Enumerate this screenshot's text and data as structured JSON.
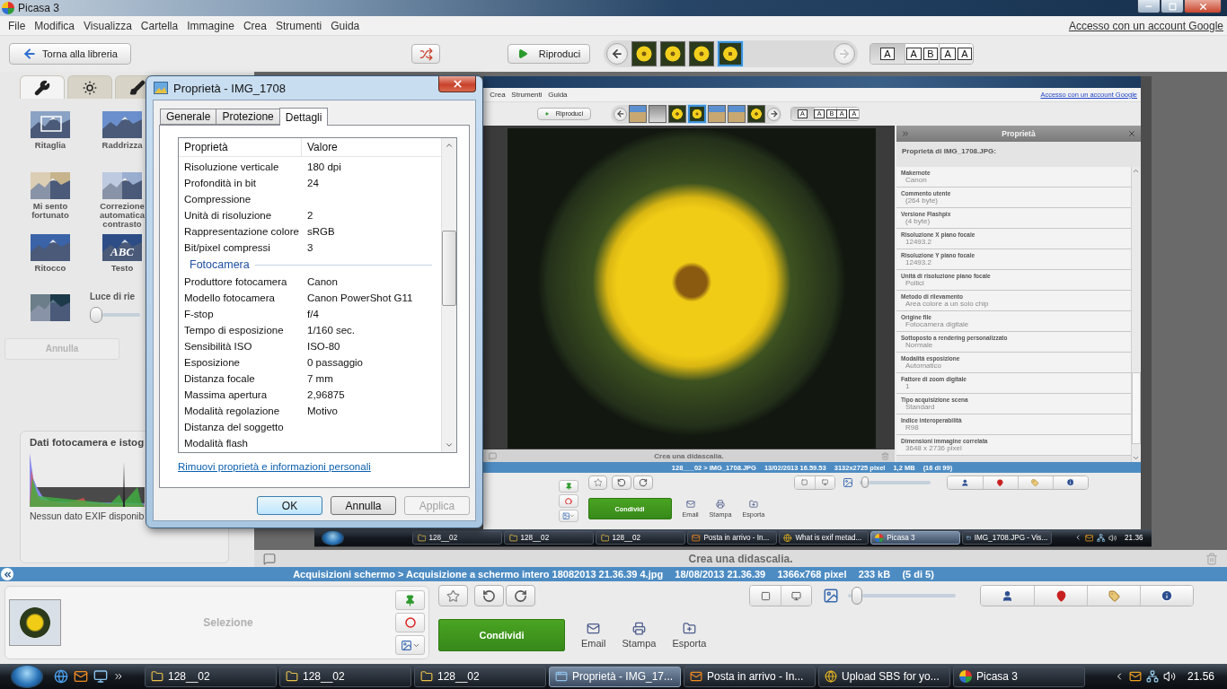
{
  "window": {
    "title": "Picasa 3"
  },
  "menu": [
    "File",
    "Modifica",
    "Visualizza",
    "Cartella",
    "Immagine",
    "Crea",
    "Strumenti",
    "Guida"
  ],
  "account_link": "Accesso con un account Google",
  "toolbar": {
    "back_button": "Torna alla libreria",
    "play_button": "Riproduci",
    "thumbnails": [
      {
        "kind": "flower",
        "selected": false
      },
      {
        "kind": "flower",
        "selected": false
      },
      {
        "kind": "flower",
        "selected": false
      },
      {
        "kind": "flower",
        "selected": true
      }
    ],
    "layouts": [
      {
        "letters": [
          "A"
        ],
        "selected": true
      },
      {
        "letters": [
          "A",
          "B"
        ],
        "selected": false
      },
      {
        "letters": [
          "A",
          "A"
        ],
        "selected": false
      }
    ]
  },
  "edit_panel": {
    "tabs": [
      {
        "kind": "wrench",
        "selected": true
      },
      {
        "kind": "sun",
        "selected": false
      },
      {
        "kind": "brush",
        "selected": false
      }
    ],
    "tools": [
      {
        "kind": "crop",
        "label": "Ritaglia"
      },
      {
        "kind": "straighten",
        "label": "Raddrizza"
      },
      {
        "kind": "lucky",
        "label": "Mi sento fortunato"
      },
      {
        "kind": "contrast",
        "label": "Correzione automatica contrasto"
      },
      {
        "kind": "retouch",
        "label": "Ritocco"
      },
      {
        "kind": "text",
        "label": "Testo"
      }
    ],
    "text_tool_icon": {
      "text": "ABC"
    },
    "light_slider": {
      "label": "Luce di rie",
      "level": 0
    },
    "undo_button": {
      "label": "Annulla",
      "disabled": true
    },
    "camera_panel": {
      "title": "Dati fotocamera e istog",
      "message": "Nessun dato EXIF disponib"
    }
  },
  "caption": "Crea una didascalia.",
  "status_bar": [
    "Acquisizioni schermo > Acquisizione a schermo intero 18082013 21.36.39 4.jpg",
    "18/08/2013 21.36.39",
    "1366x768 pixel",
    "233 kB",
    "(5 di 5)"
  ],
  "tray": {
    "label": "Selezione"
  },
  "actions": {
    "zoom_slider": {
      "level": 0.03
    },
    "share_button": "Condividi",
    "items": [
      {
        "kind": "mail",
        "label": "Email"
      },
      {
        "kind": "print",
        "label": "Stampa"
      },
      {
        "kind": "export",
        "label": "Esporta"
      }
    ]
  },
  "inner_screenshot": {
    "menu": [
      "Crea",
      "Strumenti",
      "Guida"
    ],
    "account_link": "Accesso con un account Google",
    "toolbar": {
      "play_button": "Riproduci",
      "thumbnails": [
        {
          "kind": "building",
          "selected": false
        },
        {
          "kind": "dome",
          "selected": false
        },
        {
          "kind": "flower",
          "selected": false
        },
        {
          "kind": "flower",
          "selected": true
        },
        {
          "kind": "building",
          "selected": false
        },
        {
          "kind": "building",
          "selected": false
        },
        {
          "kind": "flower",
          "selected": false
        }
      ],
      "layouts": [
        {
          "letters": [
            "A"
          ],
          "selected": true
        },
        {
          "letters": [
            "A",
            "B"
          ],
          "selected": false
        },
        {
          "letters": [
            "A",
            "A"
          ],
          "selected": false
        }
      ]
    },
    "caption": "Crea una didascalia.",
    "properties_panel": {
      "title": "Proprietà",
      "subtitle": "Proprietà di IMG_1708.JPG:",
      "items": [
        {
          "name": "Makernote",
          "value": "Canon"
        },
        {
          "name": "Commento utente",
          "value": "(264 byte)"
        },
        {
          "name": "Versione Flashpix",
          "value": "(4 byte)"
        },
        {
          "name": "Risoluzione X piano focale",
          "value": "12493.2"
        },
        {
          "name": "Risoluzione Y piano focale",
          "value": "12493.2"
        },
        {
          "name": "Unità di risoluzione piano focale",
          "value": "Pollici"
        },
        {
          "name": "Metodo di rilevamento",
          "value": "Area colore a un solo chip"
        },
        {
          "name": "Origine file",
          "value": "Fotocamera digitale"
        },
        {
          "name": "Sottoposto a rendering personalizzato",
          "value": "Normale"
        },
        {
          "name": "Modalità esposizione",
          "value": "Automatico"
        },
        {
          "name": "Fattore di zoom digitale",
          "value": "1"
        },
        {
          "name": "Tipo acquisizione scena",
          "value": "Standard"
        },
        {
          "name": "Indice interoperabilità",
          "value": "R98"
        },
        {
          "name": "Dimensioni immagine correlata",
          "value": "3648 x 2736 pixel"
        }
      ]
    },
    "status_bar": [
      "128___02 > IMG_1708.JPG",
      "13/02/2013 16.59.53",
      "3132x2725 pixel",
      "1,2 MB",
      "(16 di 99)"
    ],
    "actions": {
      "zoom_slider": {
        "level": 0.03
      },
      "share_button": "Condividi",
      "items": [
        {
          "kind": "mail",
          "label": "Email"
        },
        {
          "kind": "print",
          "label": "Stampa"
        },
        {
          "kind": "export",
          "label": "Esporta"
        }
      ]
    },
    "taskbar": {
      "tasks": [
        {
          "kind": "folder",
          "label": "128__02",
          "selected": false
        },
        {
          "kind": "folder",
          "label": "128__02",
          "selected": false
        },
        {
          "kind": "folder",
          "label": "128__02",
          "selected": false
        },
        {
          "kind": "mail",
          "label": "Posta in arrivo - In...",
          "selected": false
        },
        {
          "kind": "browser",
          "label": "What is exif metad...",
          "selected": false
        },
        {
          "kind": "picasa",
          "label": "Picasa 3",
          "selected": true
        },
        {
          "kind": "window",
          "label": "IMG_1708.JPG - Vis...",
          "selected": false
        }
      ],
      "clock": "21.36"
    }
  },
  "dialog": {
    "title": "Proprietà - IMG_1708",
    "tabs": [
      {
        "label": "Generale",
        "selected": false
      },
      {
        "label": "Protezione",
        "selected": false
      },
      {
        "label": "Dettagli",
        "selected": true
      }
    ],
    "columns": [
      "Proprietà",
      "Valore"
    ],
    "rows": [
      {
        "kind": "row",
        "name": "Risoluzione verticale",
        "value": "180 dpi"
      },
      {
        "kind": "row",
        "name": "Profondità in bit",
        "value": "24"
      },
      {
        "kind": "row",
        "name": "Compressione"
      },
      {
        "kind": "row",
        "name": "Unità di risoluzione",
        "value": "2"
      },
      {
        "kind": "row",
        "name": "Rappresentazione colore",
        "value": "sRGB"
      },
      {
        "kind": "row",
        "name": "Bit/pixel compressi",
        "value": "3"
      },
      {
        "kind": "section",
        "name": "Fotocamera"
      },
      {
        "kind": "row",
        "name": "Produttore fotocamera",
        "value": "Canon"
      },
      {
        "kind": "row",
        "name": "Modello fotocamera",
        "value": "Canon PowerShot G11"
      },
      {
        "kind": "row",
        "name": "F-stop",
        "value": "f/4"
      },
      {
        "kind": "row",
        "name": "Tempo di esposizione",
        "value": "1/160 sec."
      },
      {
        "kind": "row",
        "name": "Sensibilità ISO",
        "value": "ISO-80"
      },
      {
        "kind": "row",
        "name": "Esposizione",
        "value": "0 passaggio"
      },
      {
        "kind": "row",
        "name": "Distanza focale",
        "value": "7 mm"
      },
      {
        "kind": "row",
        "name": "Massima apertura",
        "value": "2,96875"
      },
      {
        "kind": "row",
        "name": "Modalità regolazione",
        "value": "Motivo"
      },
      {
        "kind": "row",
        "name": "Distanza del soggetto"
      },
      {
        "kind": "row",
        "name": "Modalità flash"
      }
    ],
    "link": "Rimuovi proprietà e informazioni personali",
    "buttons": [
      {
        "label": "OK",
        "focused": true,
        "disabled": false
      },
      {
        "label": "Annulla",
        "focused": false,
        "disabled": false
      },
      {
        "label": "Applica",
        "focused": false,
        "disabled": true
      }
    ]
  },
  "taskbar": {
    "tasks": [
      {
        "kind": "folder",
        "label": "128__02",
        "selected": false
      },
      {
        "kind": "folder",
        "label": "128__02",
        "selected": false
      },
      {
        "kind": "folder",
        "label": "128__02",
        "selected": false
      },
      {
        "kind": "window",
        "label": "Proprietà - IMG_17...",
        "selected": true
      },
      {
        "kind": "mail",
        "label": "Posta in arrivo - In...",
        "selected": false
      },
      {
        "kind": "browser",
        "label": "Upload SBS for yo...",
        "selected": false
      },
      {
        "kind": "picasa",
        "label": "Picasa 3",
        "selected": false
      }
    ],
    "clock": "21.56"
  }
}
